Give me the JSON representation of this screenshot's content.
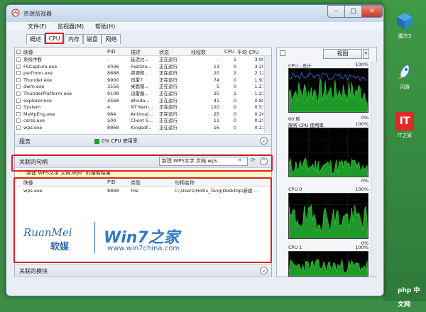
{
  "window": {
    "title": "资源监视器"
  },
  "menu": {
    "file": "文件(F)",
    "monitor": "监视器(M)",
    "help": "帮助(H)"
  },
  "tabs": [
    "概述",
    "CPU",
    "内存",
    "磁盘",
    "网络"
  ],
  "process_table": {
    "headers": [
      "映像",
      "PID",
      "描述",
      "状态",
      "线程数",
      "CPU",
      "平均 CPU"
    ],
    "rows": [
      [
        "系统中断",
        "-",
        "延迟过...",
        "正在运行",
        "-",
        "1",
        "3.99"
      ],
      [
        "FSCapture.exe",
        "4036",
        "FastSto...",
        "正在运行",
        "13",
        "0",
        "3.29"
      ],
      [
        "perfmon.exe",
        "8888",
        "资源和...",
        "正在运行",
        "20",
        "2",
        "2.12"
      ],
      [
        "Thunder.exe",
        "9900",
        "迅雷7",
        "正在运行",
        "74",
        "0",
        "1.93"
      ],
      [
        "dwm.exe",
        "3556",
        "桌面窗...",
        "正在运行",
        "5",
        "0",
        "1.27"
      ],
      [
        "ThunderPlatform.exe",
        "9108",
        "迅雷服...",
        "正在运行",
        "25",
        "1",
        "1.21"
      ],
      [
        "explorer.exe",
        "3568",
        "Windo...",
        "正在运行",
        "41",
        "0",
        "0.89"
      ],
      [
        "System",
        "4",
        "NT Kern...",
        "正在运行",
        "120",
        "0",
        "0.53"
      ],
      [
        "MsMpEng.exe",
        "984",
        "Antimal...",
        "正在运行",
        "25",
        "0",
        "0.26"
      ],
      [
        "csrss.exe",
        "500",
        "Client S...",
        "正在运行",
        "11",
        "0",
        "0.25"
      ],
      [
        "wps.exe",
        "8868",
        "Kingsof...",
        "正在运行",
        "16",
        "0",
        "0.21"
      ]
    ]
  },
  "services": {
    "label": "服务",
    "cpu_usage": "0% CPU 使用率"
  },
  "handles": {
    "label": "关联的句柄",
    "search_value": "新建 WPS文字 文档.wps",
    "results_caption": "\"新建 WPS文字 文档.wps\" 的搜索结果",
    "headers": [
      "映像",
      "PID",
      "类型",
      "句柄名称"
    ],
    "rows": [
      [
        "wps.exe",
        "8868",
        "File",
        "C:\\Users\\Hollis_Tang\\Desktop\\新建 ..."
      ]
    ]
  },
  "watermark": {
    "left_brand": "RuanMei",
    "left_sub": "软媒",
    "right_brand": "Win7之家",
    "right_url": "www.win7china.com"
  },
  "modules": {
    "label": "关联的模块"
  },
  "right_panel": {
    "view_button": "视图",
    "graphs": [
      {
        "title": "CPU - 总计",
        "pct_top": "100%",
        "left_bottom": "60 秒",
        "pct_bottom": "0%"
      },
      {
        "title": "服务 CPU 使用率",
        "pct_top": "100%",
        "pct_bottom": "0%"
      },
      {
        "title": "CPU 0",
        "pct_top": "100%",
        "pct_bottom": "0%"
      },
      {
        "title": "CPU 1",
        "pct_top": "100%",
        "pct_bottom": ""
      }
    ]
  },
  "desktop": {
    "icon1": "魔方3",
    "icon2": "闪游",
    "icon3": "IT之家",
    "site_badge": "php 中文网"
  },
  "colors": {
    "highlight_red": "#dd2222",
    "graph_green": "#2bd33a",
    "graph_blue": "#4a6bff"
  }
}
